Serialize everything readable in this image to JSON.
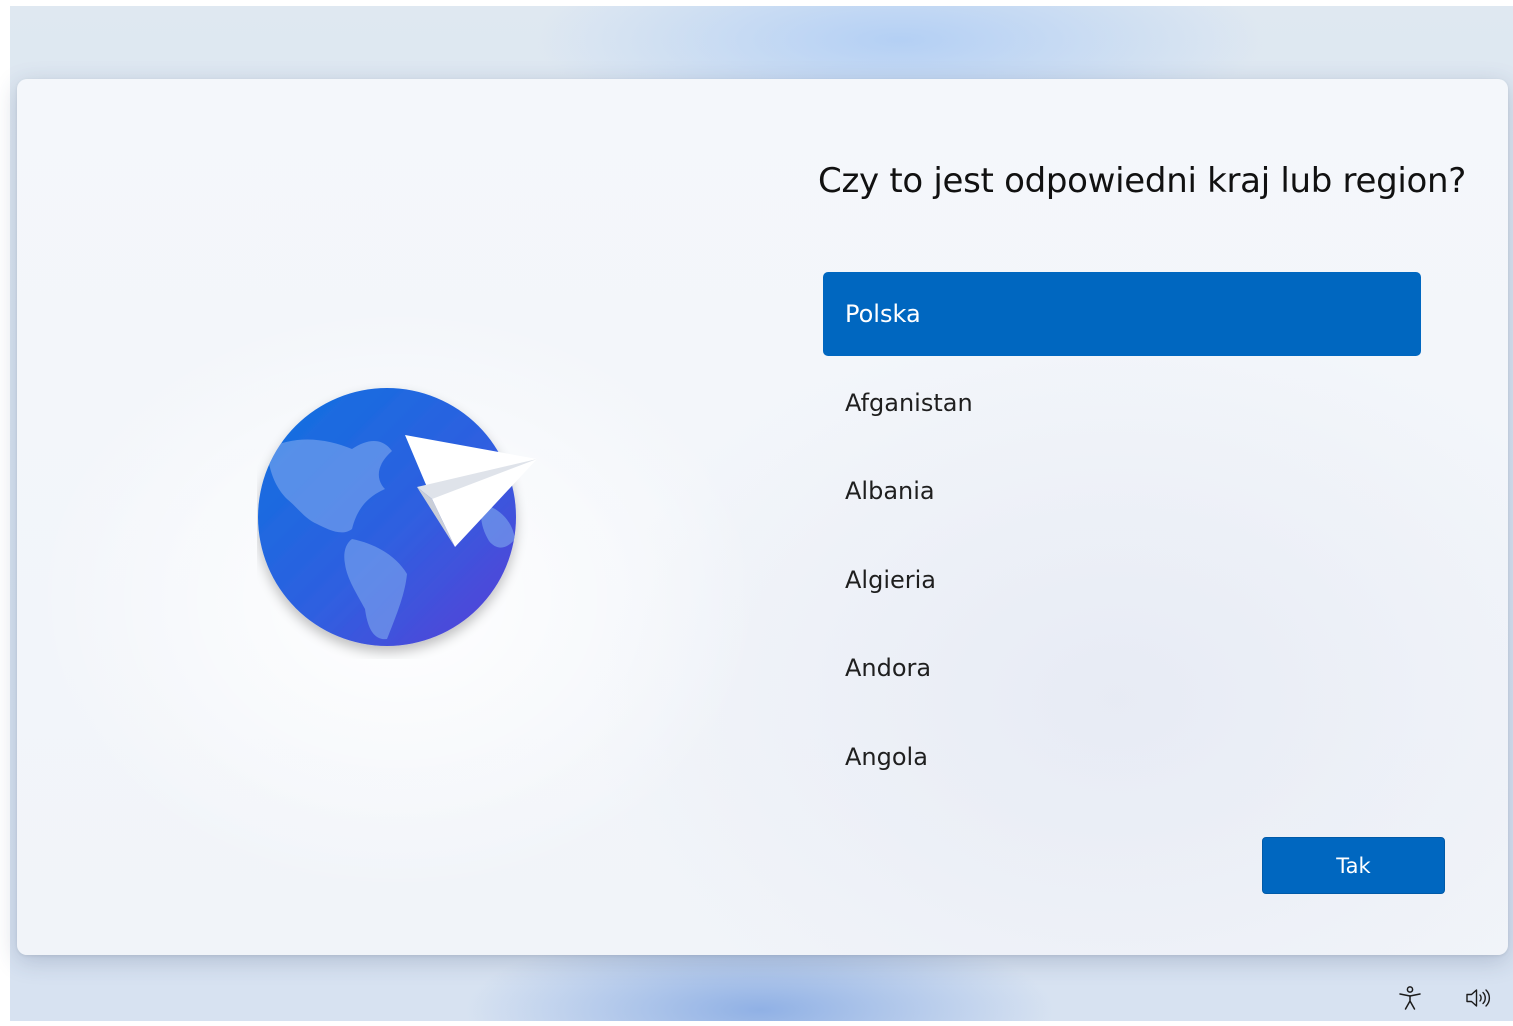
{
  "page": {
    "title": "Czy to jest odpowiedni kraj lub region?"
  },
  "regions": {
    "items": [
      {
        "label": "Polska",
        "selected": true
      },
      {
        "label": "Afganistan",
        "selected": false
      },
      {
        "label": "Albania",
        "selected": false
      },
      {
        "label": "Algieria",
        "selected": false
      },
      {
        "label": "Andora",
        "selected": false
      },
      {
        "label": "Angola",
        "selected": false
      }
    ]
  },
  "actions": {
    "confirm_label": "Tak"
  },
  "tray": {
    "icons": [
      "accessibility-icon",
      "volume-icon"
    ]
  },
  "colors": {
    "accent": "#0067c0",
    "selected_text": "#ffffff",
    "title_text": "#111111"
  }
}
